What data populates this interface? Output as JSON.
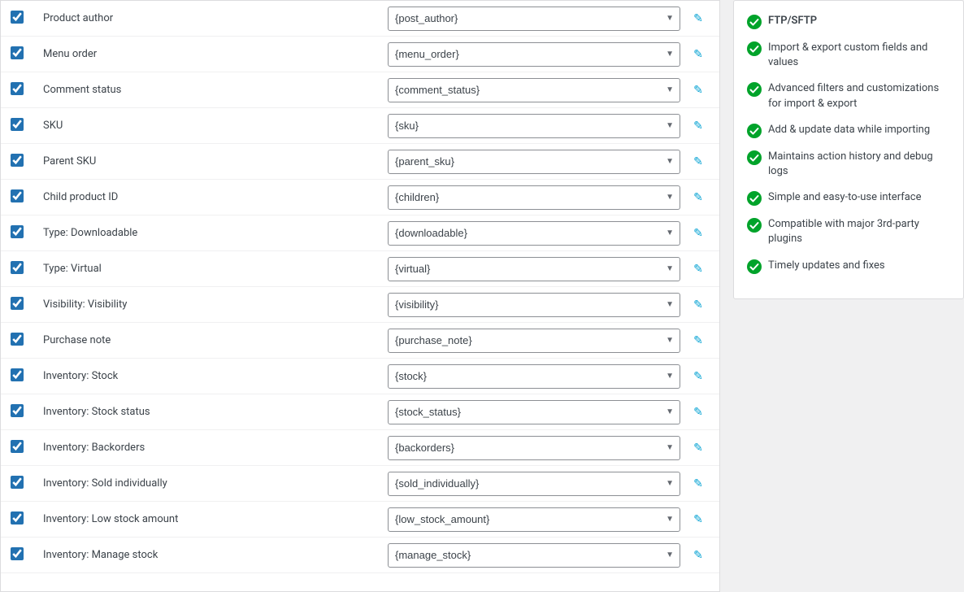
{
  "rows": [
    {
      "id": "product-author",
      "label": "Product author",
      "value": "{post_author}",
      "checked": true
    },
    {
      "id": "menu-order",
      "label": "Menu order",
      "value": "{menu_order}",
      "checked": true
    },
    {
      "id": "comment-status",
      "label": "Comment status",
      "value": "{comment_status}",
      "checked": true
    },
    {
      "id": "sku",
      "label": "SKU",
      "value": "{sku}",
      "checked": true
    },
    {
      "id": "parent-sku",
      "label": "Parent SKU",
      "value": "{parent_sku}",
      "checked": true
    },
    {
      "id": "child-product-id",
      "label": "Child product ID",
      "value": "{children}",
      "checked": true
    },
    {
      "id": "type-downloadable",
      "label": "Type: Downloadable",
      "value": "{downloadable}",
      "checked": true
    },
    {
      "id": "type-virtual",
      "label": "Type: Virtual",
      "value": "{virtual}",
      "checked": true
    },
    {
      "id": "visibility-visibility",
      "label": "Visibility: Visibility",
      "value": "{visibility}",
      "checked": true
    },
    {
      "id": "purchase-note",
      "label": "Purchase note",
      "value": "{purchase_note}",
      "checked": true
    },
    {
      "id": "inventory-stock",
      "label": "Inventory: Stock",
      "value": "{stock}",
      "checked": true
    },
    {
      "id": "inventory-stock-status",
      "label": "Inventory: Stock status",
      "value": "{stock_status}",
      "checked": true
    },
    {
      "id": "inventory-backorders",
      "label": "Inventory: Backorders",
      "value": "{backorders}",
      "checked": true
    },
    {
      "id": "inventory-sold-individually",
      "label": "Inventory: Sold individually",
      "value": "{sold_individually}",
      "checked": true
    },
    {
      "id": "inventory-low-stock-amount",
      "label": "Inventory: Low stock amount",
      "value": "{low_stock_amount}",
      "checked": true
    },
    {
      "id": "inventory-manage-stock",
      "label": "Inventory: Manage stock",
      "value": "{manage_stock}",
      "checked": true
    }
  ],
  "sidebar": {
    "features": [
      {
        "id": "ftp-sftp",
        "text": "FTP/SFTP",
        "bold": true
      },
      {
        "id": "import-export-custom",
        "text": "Import & export custom fields and values",
        "bold": false
      },
      {
        "id": "advanced-filters",
        "text": "Advanced filters and customizations for import & export",
        "bold": false
      },
      {
        "id": "add-update-data",
        "text": "Add & update data while importing",
        "bold": false
      },
      {
        "id": "action-history",
        "text": "Maintains action history and debug logs",
        "bold": false
      },
      {
        "id": "simple-interface",
        "text": "Simple and easy-to-use interface",
        "bold": false
      },
      {
        "id": "compatible-3rd-party",
        "text": "Compatible with major 3rd-party plugins",
        "bold": false
      },
      {
        "id": "timely-updates",
        "text": "Timely updates and fixes",
        "bold": false
      }
    ]
  }
}
